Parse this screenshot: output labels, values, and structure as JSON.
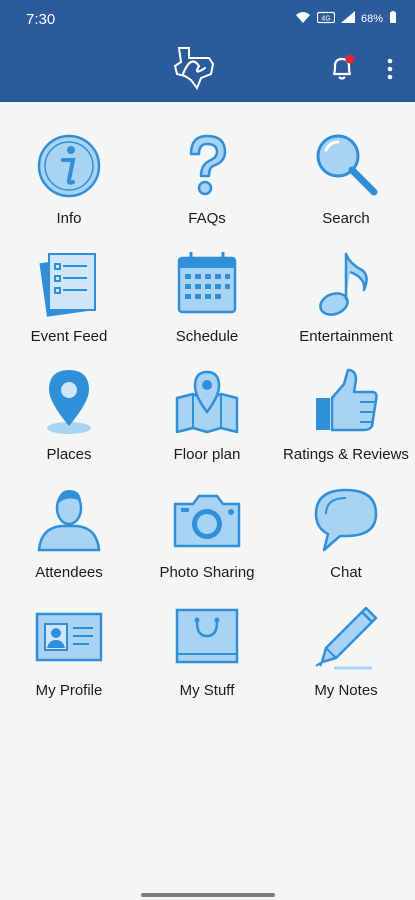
{
  "status_bar": {
    "time": "7:30",
    "battery": "68%",
    "icons": [
      "wifi-icon",
      "volte-icon",
      "signal-icon",
      "battery-icon"
    ]
  },
  "app_bar": {
    "logo": "Texas Rose logo",
    "notification_icon": "bell-icon",
    "notification_badge_color": "#e8232b",
    "menu_icon": "more-vertical-icon"
  },
  "colors": {
    "header": "#2b5b9d",
    "icon_fill": "#a9d3f2",
    "icon_stroke": "#2f8fd8",
    "background": "#f4f5f5"
  },
  "tiles": [
    {
      "label": "Info",
      "icon": "info-icon"
    },
    {
      "label": "FAQs",
      "icon": "question-icon"
    },
    {
      "label": "Search",
      "icon": "magnifier-icon"
    },
    {
      "label": "Event Feed",
      "icon": "document-stack-icon"
    },
    {
      "label": "Schedule",
      "icon": "calendar-icon"
    },
    {
      "label": "Entertainment",
      "icon": "music-note-icon"
    },
    {
      "label": "Places",
      "icon": "map-pin-icon"
    },
    {
      "label": "Floor plan",
      "icon": "map-icon"
    },
    {
      "label": "Ratings & Reviews",
      "icon": "thumbs-up-icon"
    },
    {
      "label": "Attendees",
      "icon": "person-icon"
    },
    {
      "label": "Photo Sharing",
      "icon": "camera-icon"
    },
    {
      "label": "Chat",
      "icon": "speech-bubble-icon"
    },
    {
      "label": "My Profile",
      "icon": "id-card-icon"
    },
    {
      "label": "My Stuff",
      "icon": "shopping-bag-icon"
    },
    {
      "label": "My Notes",
      "icon": "pen-icon"
    }
  ]
}
